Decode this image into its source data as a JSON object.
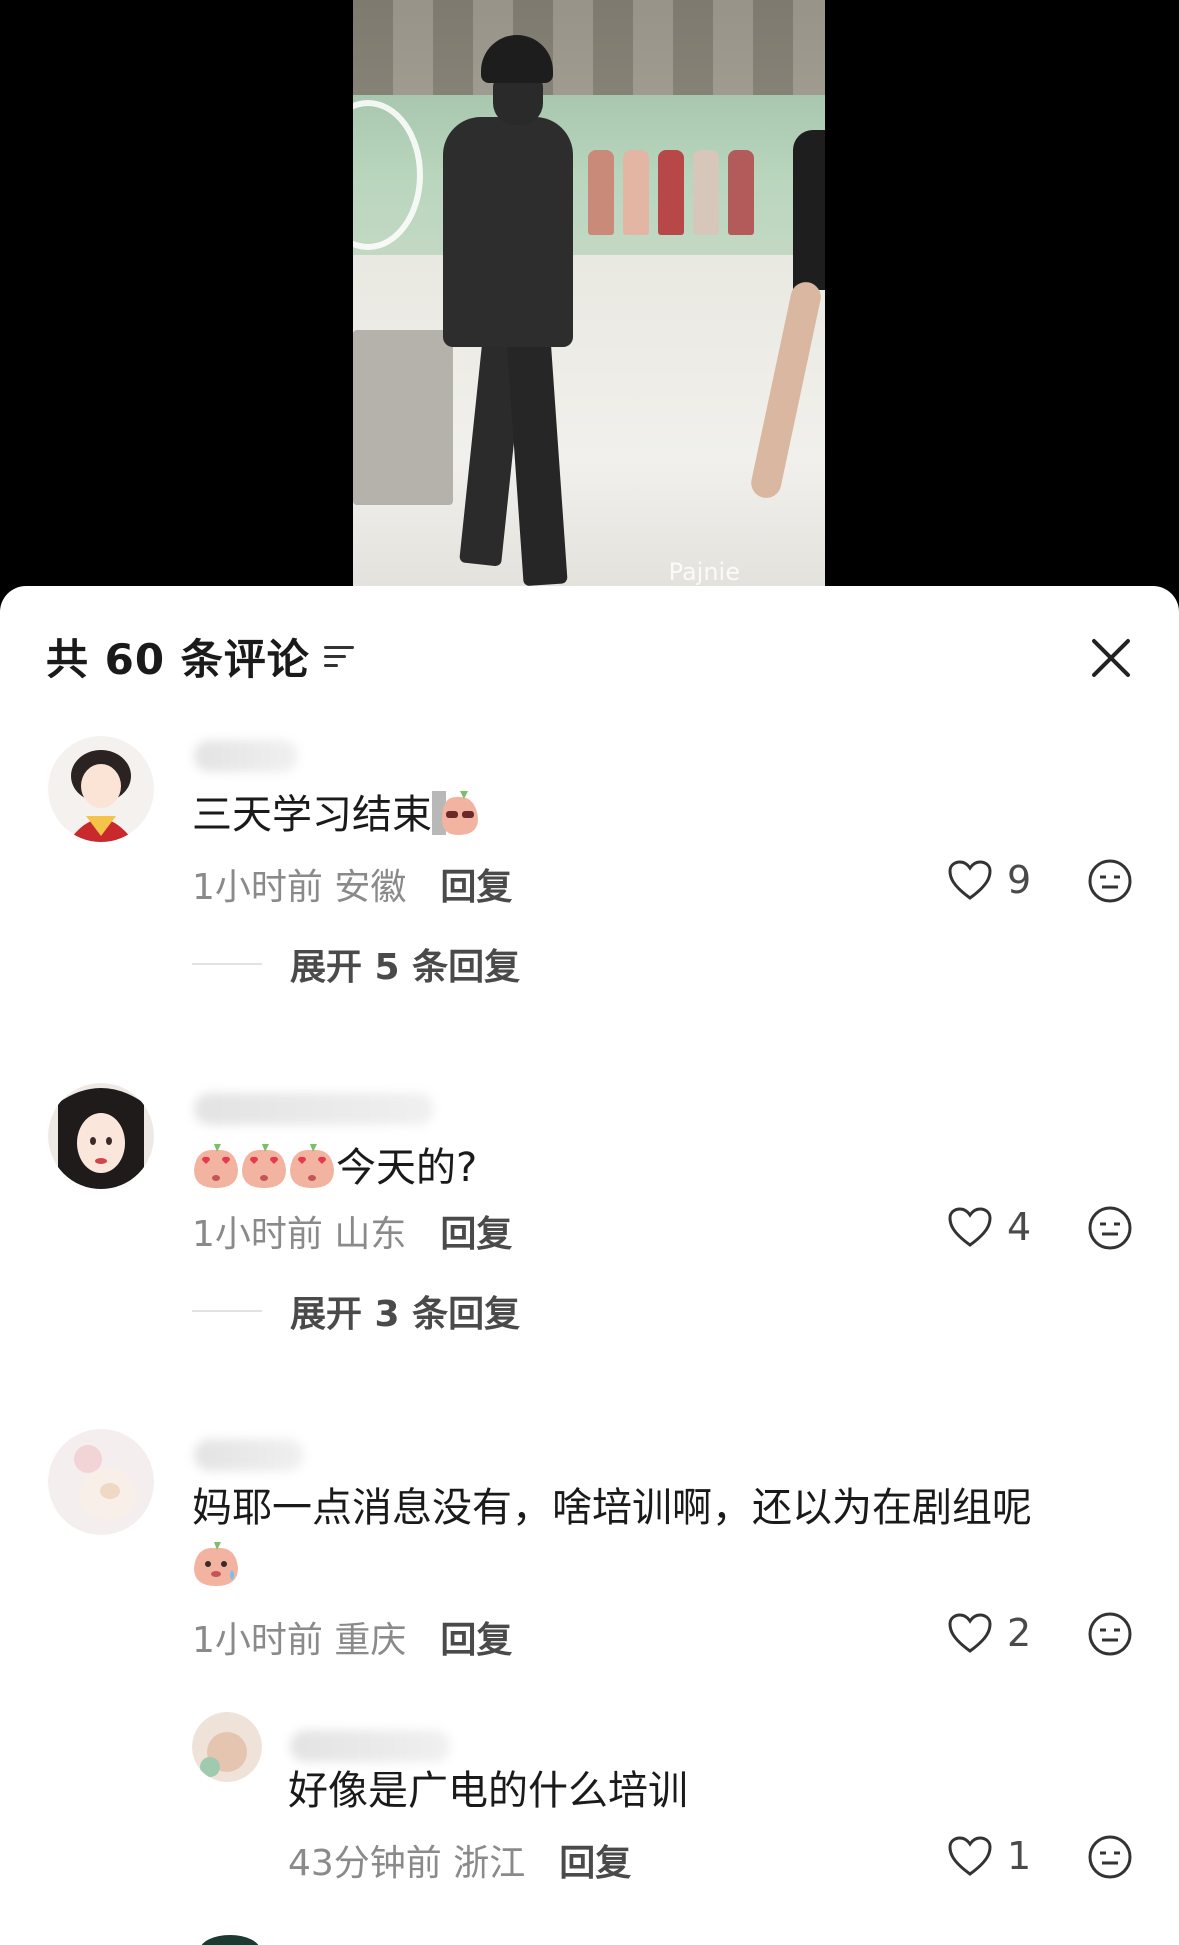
{
  "video": {
    "watermark": "Pajnie"
  },
  "header": {
    "title": "共 60 条评论"
  },
  "comments": [
    {
      "text": "三天学习结束",
      "emoji": "peach-glasses",
      "time": "1小时前",
      "location": "安徽",
      "reply_label": "回复",
      "likes": "9",
      "expand_label": "展开 5 条回复"
    },
    {
      "text": "今天的?",
      "emoji": "peach-heart-eyes",
      "time": "1小时前",
      "location": "山东",
      "reply_label": "回复",
      "likes": "4",
      "expand_label": "展开 3 条回复"
    },
    {
      "text": "妈耶一点消息没有，啥培训啊，还以为在剧组呢",
      "emoji": "peach-sweat",
      "time": "1小时前",
      "location": "重庆",
      "reply_label": "回复",
      "likes": "2"
    }
  ],
  "reply": {
    "text": "好像是广电的什么培训",
    "time": "43分钟前",
    "location": "浙江",
    "reply_label": "回复",
    "likes": "1"
  },
  "colors": {
    "sheet_bg": "#ffffff",
    "text_primary": "#1a1a1a",
    "text_meta": "#8a8a8a",
    "peach": "#f2b3a0"
  }
}
